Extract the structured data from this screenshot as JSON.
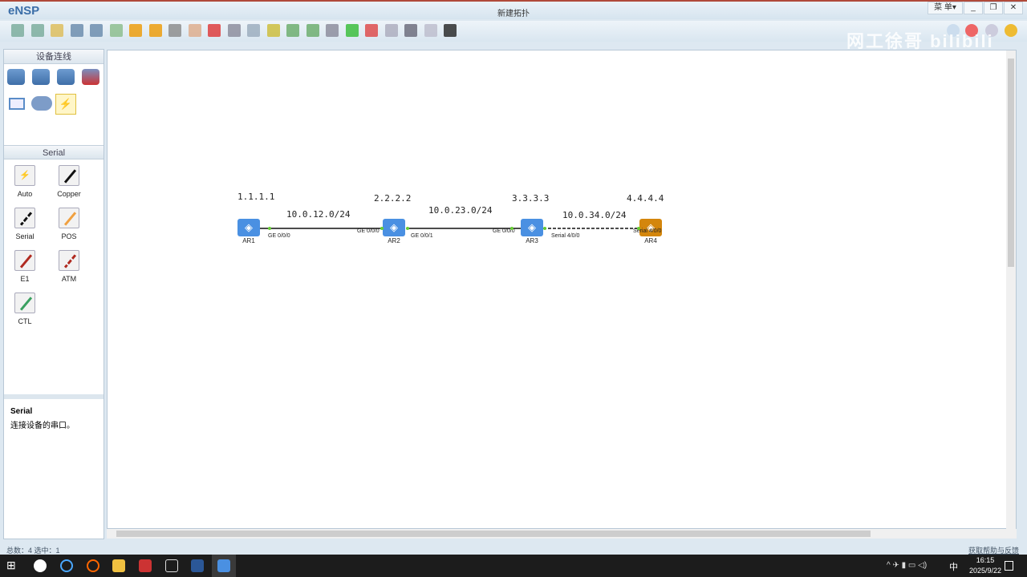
{
  "app": {
    "name": "eNSP",
    "window_title": "新建拓扑",
    "menu_label": "菜 单▾",
    "min": "_",
    "restore": "❐",
    "close": "✕"
  },
  "watermark": "网工徐哥 bilibili",
  "toolbar": [
    "new-topology",
    "new-lab",
    "open",
    "save",
    "save-as",
    "print",
    "undo",
    "redo",
    "select",
    "pan",
    "delete",
    "delete-all-links",
    "text",
    "palette",
    "zoom-in",
    "zoom-out",
    "fit",
    "start-device",
    "stop-device",
    "capture",
    "topology",
    "display-grid",
    "console"
  ],
  "left_panel": {
    "section1_title": "设备连线",
    "section2_title": "Serial",
    "cables": [
      {
        "label": "Auto",
        "color": "#111"
      },
      {
        "label": "Copper",
        "color": "#111"
      },
      {
        "label": "Serial",
        "color": "#111"
      },
      {
        "label": "POS",
        "color": "#f0a040"
      },
      {
        "label": "E1",
        "color": "#b02a20"
      },
      {
        "label": "ATM",
        "color": "#b02a20"
      },
      {
        "label": "CTL",
        "color": "#3aa060"
      }
    ],
    "desc_title": "Serial",
    "desc_text": "连接设备的串口。"
  },
  "topology": {
    "devices": [
      {
        "name": "AR1",
        "loopback": "1.1.1.1",
        "color": "#4a90e2"
      },
      {
        "name": "AR2",
        "loopback": "2.2.2.2",
        "color": "#4a90e2"
      },
      {
        "name": "AR3",
        "loopback": "3.3.3.3",
        "color": "#4a90e2"
      },
      {
        "name": "AR4",
        "loopback": "4.4.4.4",
        "color": "#d4860c"
      }
    ],
    "links": [
      {
        "subnet": "10.0.12.0/24",
        "a_port": "GE 0/0/0",
        "b_port": "GE 0/0/0"
      },
      {
        "subnet": "10.0.23.0/24",
        "a_port": "GE 0/0/1",
        "b_port": "GE 0/0/0"
      },
      {
        "subnet": "10.0.34.0/24",
        "a_port": "Serial 4/0/0",
        "b_port": "Serial 4/0/0"
      }
    ]
  },
  "status": {
    "left": "总数：4 选中：1",
    "right": "获取帮助与反馈"
  },
  "taskbar": {
    "time": "16:15",
    "date": "2025/9/22",
    "ime": "中"
  }
}
